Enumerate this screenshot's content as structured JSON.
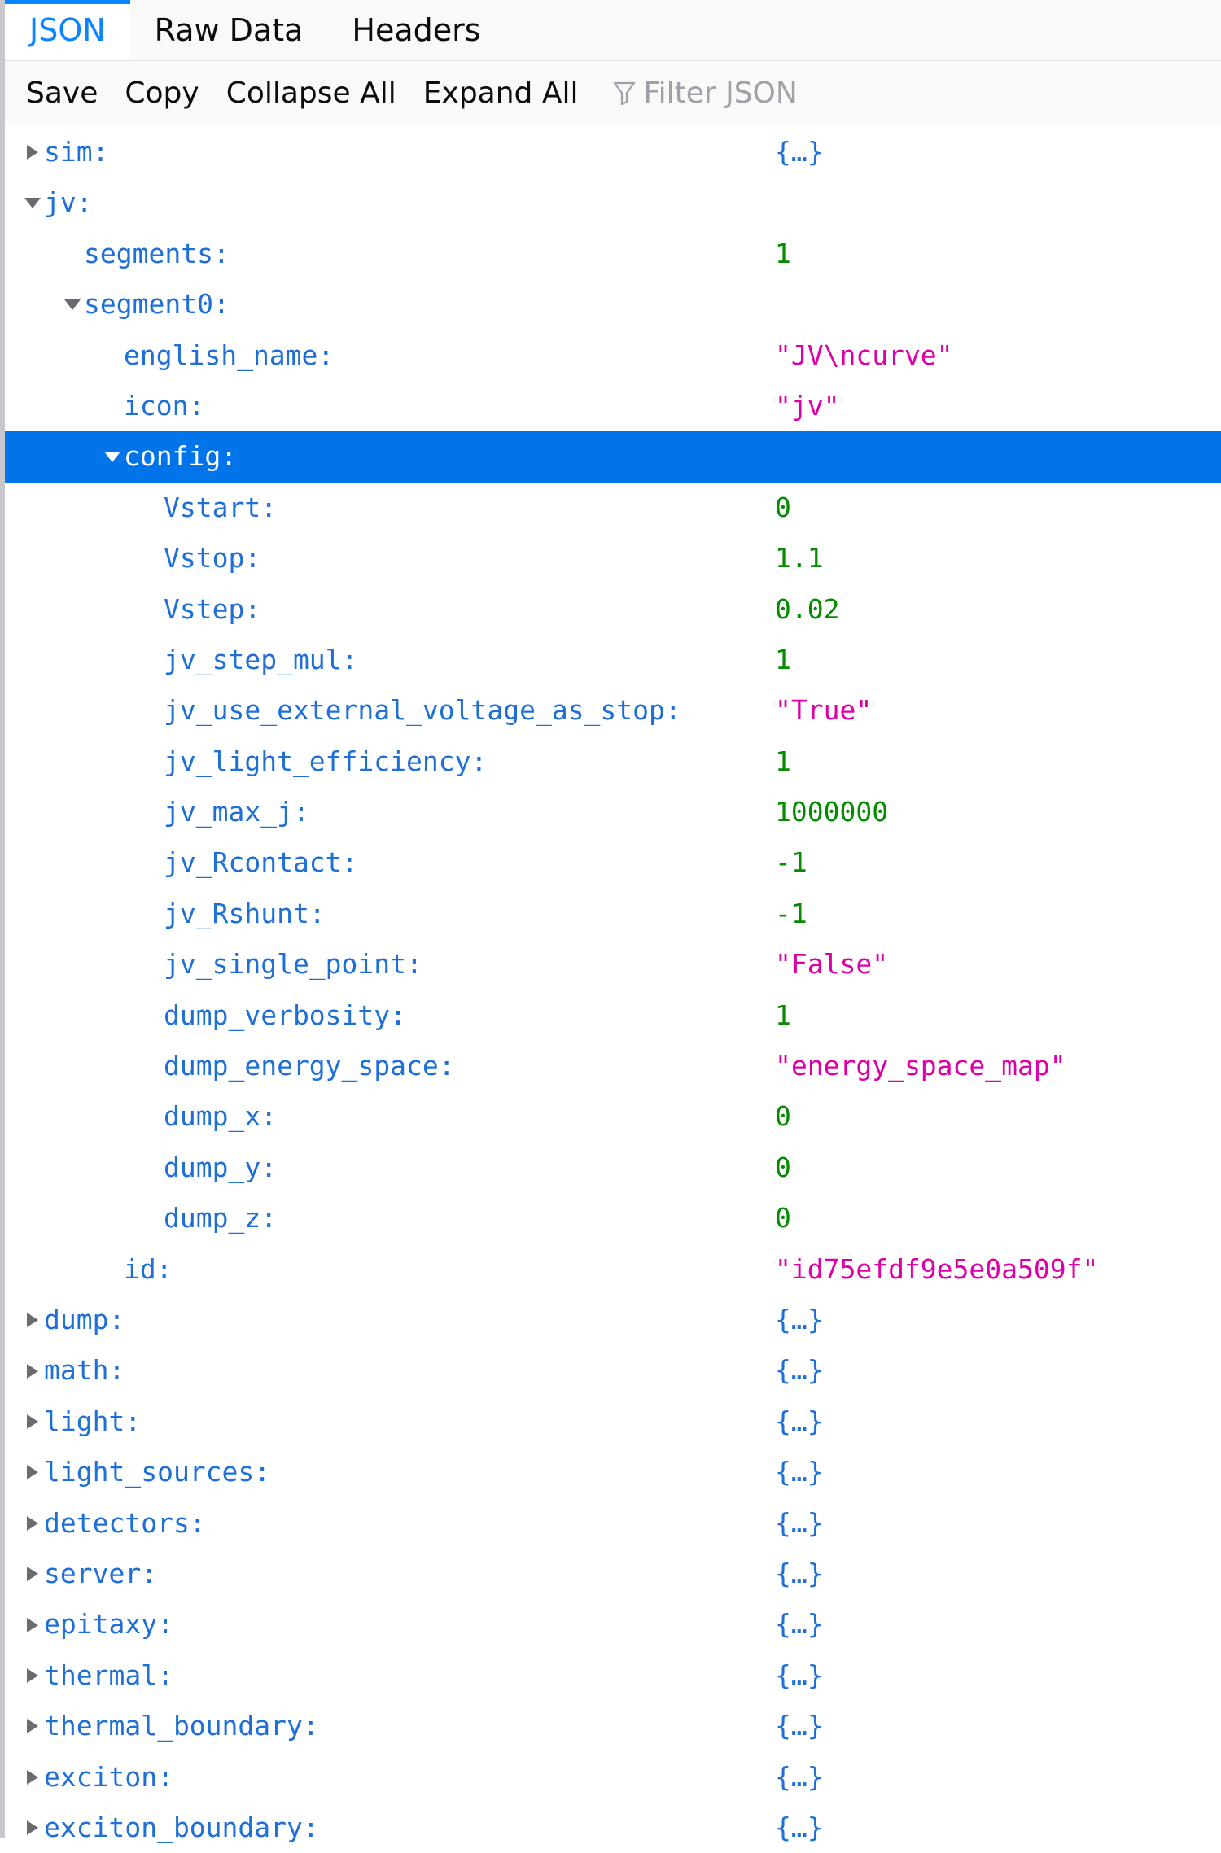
{
  "tabs": [
    {
      "label": "JSON",
      "selected": true
    },
    {
      "label": "Raw Data",
      "selected": false
    },
    {
      "label": "Headers",
      "selected": false
    }
  ],
  "toolbar": {
    "save_label": "Save",
    "copy_label": "Copy",
    "collapse_label": "Collapse All",
    "expand_label": "Expand All",
    "filter_placeholder": "Filter JSON",
    "filter_icon": "funnel-icon"
  },
  "colors": {
    "accent": "#0a84ff",
    "selected_row": "#0074e8",
    "key": "#1e6fd6",
    "number": "#058b00",
    "string": "#dd00a9"
  },
  "tree": [
    {
      "key": "sim:",
      "value": "{…}",
      "type": "obj",
      "depth": 0,
      "toggle": "collapsed"
    },
    {
      "key": "jv:",
      "value": "",
      "type": "none",
      "depth": 0,
      "toggle": "expanded"
    },
    {
      "key": "segments:",
      "value": "1",
      "type": "num",
      "depth": 1,
      "toggle": "none"
    },
    {
      "key": "segment0:",
      "value": "",
      "type": "none",
      "depth": 1,
      "toggle": "expanded"
    },
    {
      "key": "english_name:",
      "value": "\"JV\\ncurve\"",
      "type": "str",
      "depth": 2,
      "toggle": "none"
    },
    {
      "key": "icon:",
      "value": "\"jv\"",
      "type": "str",
      "depth": 2,
      "toggle": "none"
    },
    {
      "key": "config:",
      "value": "",
      "type": "none",
      "depth": 2,
      "toggle": "expanded",
      "selected": true
    },
    {
      "key": "Vstart:",
      "value": "0",
      "type": "num",
      "depth": 3,
      "toggle": "none"
    },
    {
      "key": "Vstop:",
      "value": "1.1",
      "type": "num",
      "depth": 3,
      "toggle": "none"
    },
    {
      "key": "Vstep:",
      "value": "0.02",
      "type": "num",
      "depth": 3,
      "toggle": "none"
    },
    {
      "key": "jv_step_mul:",
      "value": "1",
      "type": "num",
      "depth": 3,
      "toggle": "none"
    },
    {
      "key": "jv_use_external_voltage_as_stop:",
      "value": "\"True\"",
      "type": "str",
      "depth": 3,
      "toggle": "none"
    },
    {
      "key": "jv_light_efficiency:",
      "value": "1",
      "type": "num",
      "depth": 3,
      "toggle": "none"
    },
    {
      "key": "jv_max_j:",
      "value": "1000000",
      "type": "num",
      "depth": 3,
      "toggle": "none"
    },
    {
      "key": "jv_Rcontact:",
      "value": "-1",
      "type": "num",
      "depth": 3,
      "toggle": "none"
    },
    {
      "key": "jv_Rshunt:",
      "value": "-1",
      "type": "num",
      "depth": 3,
      "toggle": "none"
    },
    {
      "key": "jv_single_point:",
      "value": "\"False\"",
      "type": "str",
      "depth": 3,
      "toggle": "none"
    },
    {
      "key": "dump_verbosity:",
      "value": "1",
      "type": "num",
      "depth": 3,
      "toggle": "none"
    },
    {
      "key": "dump_energy_space:",
      "value": "\"energy_space_map\"",
      "type": "str",
      "depth": 3,
      "toggle": "none"
    },
    {
      "key": "dump_x:",
      "value": "0",
      "type": "num",
      "depth": 3,
      "toggle": "none"
    },
    {
      "key": "dump_y:",
      "value": "0",
      "type": "num",
      "depth": 3,
      "toggle": "none"
    },
    {
      "key": "dump_z:",
      "value": "0",
      "type": "num",
      "depth": 3,
      "toggle": "none"
    },
    {
      "key": "id:",
      "value": "\"id75efdf9e5e0a509f\"",
      "type": "str",
      "depth": 2,
      "toggle": "none"
    },
    {
      "key": "dump:",
      "value": "{…}",
      "type": "obj",
      "depth": 0,
      "toggle": "collapsed"
    },
    {
      "key": "math:",
      "value": "{…}",
      "type": "obj",
      "depth": 0,
      "toggle": "collapsed"
    },
    {
      "key": "light:",
      "value": "{…}",
      "type": "obj",
      "depth": 0,
      "toggle": "collapsed"
    },
    {
      "key": "light_sources:",
      "value": "{…}",
      "type": "obj",
      "depth": 0,
      "toggle": "collapsed"
    },
    {
      "key": "detectors:",
      "value": "{…}",
      "type": "obj",
      "depth": 0,
      "toggle": "collapsed"
    },
    {
      "key": "server:",
      "value": "{…}",
      "type": "obj",
      "depth": 0,
      "toggle": "collapsed"
    },
    {
      "key": "epitaxy:",
      "value": "{…}",
      "type": "obj",
      "depth": 0,
      "toggle": "collapsed"
    },
    {
      "key": "thermal:",
      "value": "{…}",
      "type": "obj",
      "depth": 0,
      "toggle": "collapsed"
    },
    {
      "key": "thermal_boundary:",
      "value": "{…}",
      "type": "obj",
      "depth": 0,
      "toggle": "collapsed"
    },
    {
      "key": "exciton:",
      "value": "{…}",
      "type": "obj",
      "depth": 0,
      "toggle": "collapsed"
    },
    {
      "key": "exciton_boundary:",
      "value": "{…}",
      "type": "obj",
      "depth": 0,
      "toggle": "collapsed"
    }
  ]
}
